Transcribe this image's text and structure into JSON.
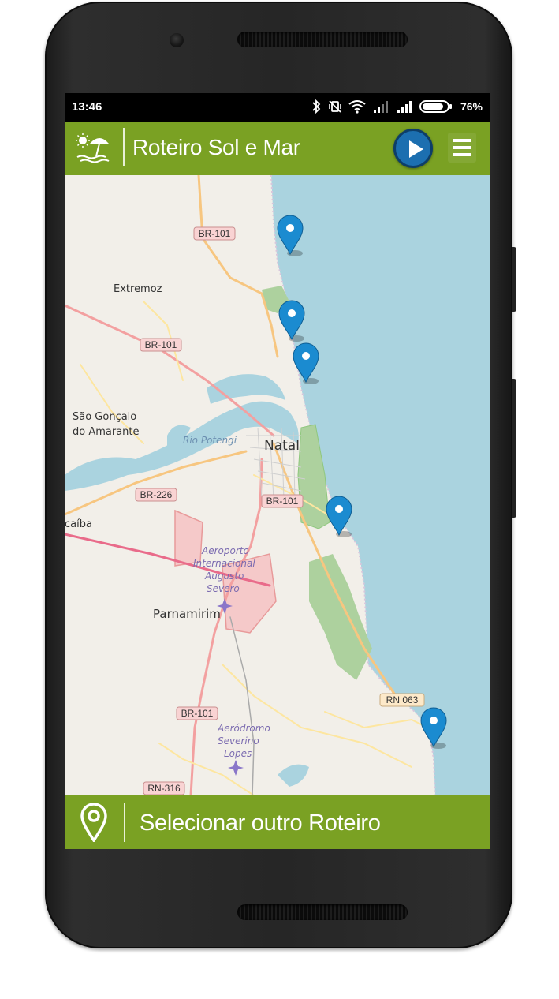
{
  "status_bar": {
    "time": "13:46",
    "battery": "76%",
    "icons": [
      "bluetooth-icon",
      "vibrate-icon",
      "wifi-icon",
      "signal-icon",
      "signal-icon",
      "battery-icon"
    ]
  },
  "app_bar": {
    "title": "Roteiro Sol e Mar",
    "logo_icon": "beach-umbrella-icon",
    "play_icon": "play-icon",
    "menu_icon": "hamburger-menu-icon"
  },
  "map": {
    "labels": {
      "br101_north": "BR-101",
      "extremoz": "Extremoz",
      "br101_west": "BR-101",
      "sao_goncalo_1": "São Gonçalo",
      "sao_goncalo_2": "do Amarante",
      "rio_potengi": "Rio Potengi",
      "natal": "Natal",
      "br226": "BR-226",
      "br101_center": "BR-101",
      "macaiba": "caíba",
      "airport_1": "Aeroporto",
      "airport_2": "Internacional",
      "airport_3": "Augusto",
      "airport_4": "Severo",
      "parnamirim": "Parnamirim",
      "rn063": "RN 063",
      "br101_south": "BR-101",
      "aerodromo_1": "Aeródromo",
      "aerodromo_2": "Severino",
      "aerodromo_3": "Lopes",
      "rn316": "RN-316"
    },
    "marker_count": 5
  },
  "bottom_bar": {
    "label": "Selecionar outro Roteiro",
    "icon": "location-pin-icon"
  },
  "colors": {
    "accent_green": "#7aa123",
    "play_blue": "#1c6fb0",
    "sea": "#aad3df",
    "land": "#f2efe9",
    "marker_blue": "#1b8bd0"
  }
}
